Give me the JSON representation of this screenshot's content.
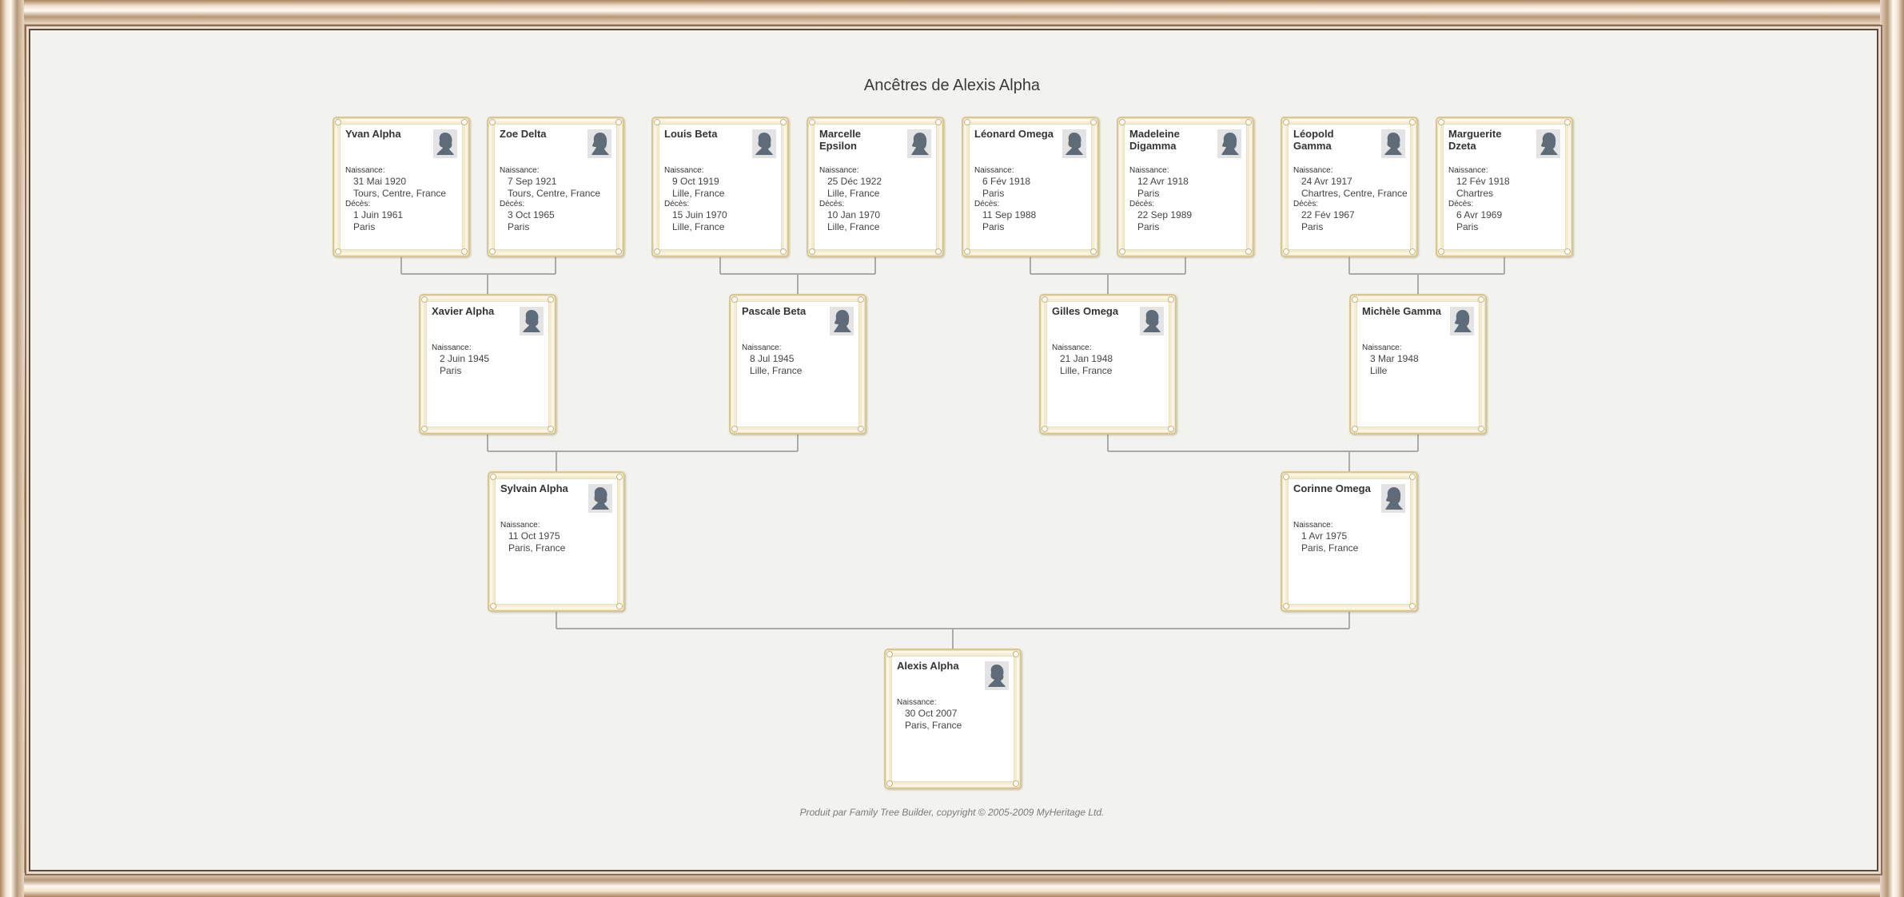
{
  "title": "Ancêtres de Alexis Alpha",
  "footer": "Produit par Family Tree Builder, copyright © 2005-2009 MyHeritage Ltd.",
  "colors": {
    "card_border": "#d9c78f",
    "connector": "#aaaaaa",
    "background": "#f2f2ee"
  },
  "labels": {
    "birth": "Naissance:",
    "death": "Décès:"
  },
  "persons": [
    {
      "id": "p1",
      "name": "Yvan Alpha",
      "icon": "male-silhouette-icon",
      "birth_date": "31 Mai 1920",
      "birth_place": "Tours, Centre, France",
      "death_date": "1 Juin 1961",
      "death_place": "Paris"
    },
    {
      "id": "p2",
      "name": "Zoe Delta",
      "icon": "female-silhouette-icon",
      "birth_date": "7 Sep 1921",
      "birth_place": "Tours, Centre, France",
      "death_date": "3 Oct 1965",
      "death_place": "Paris"
    },
    {
      "id": "p3",
      "name": "Louis Beta",
      "icon": "male-silhouette-icon",
      "birth_date": "9 Oct 1919",
      "birth_place": "Lille, France",
      "death_date": "15 Juin 1970",
      "death_place": "Lille, France"
    },
    {
      "id": "p4",
      "name": "Marcelle Epsilon",
      "icon": "female-silhouette-icon",
      "birth_date": "25 Déc 1922",
      "birth_place": "Lille, France",
      "death_date": "10 Jan 1970",
      "death_place": "Lille, France"
    },
    {
      "id": "p5",
      "name": "Léonard Omega",
      "icon": "male-silhouette-icon",
      "birth_date": "6 Fév 1918",
      "birth_place": "Paris",
      "death_date": "11 Sep 1988",
      "death_place": "Paris"
    },
    {
      "id": "p6",
      "name": "Madeleine Digamma",
      "icon": "female-silhouette-icon",
      "birth_date": "12 Avr 1918",
      "birth_place": "Paris",
      "death_date": "22 Sep 1989",
      "death_place": "Paris"
    },
    {
      "id": "p7",
      "name": "Léopold Gamma",
      "icon": "male-silhouette-icon",
      "birth_date": "24 Avr 1917",
      "birth_place": "Chartres, Centre, France",
      "death_date": "22 Fév 1967",
      "death_place": "Paris"
    },
    {
      "id": "p8",
      "name": "Marguerite Dzeta",
      "icon": "female-silhouette-icon",
      "birth_date": "12 Fév 1918",
      "birth_place": "Chartres",
      "death_date": "6 Avr 1969",
      "death_place": "Paris"
    },
    {
      "id": "p9",
      "name": "Xavier Alpha",
      "icon": "male-silhouette-icon",
      "birth_date": "2 Juin 1945",
      "birth_place": "Paris"
    },
    {
      "id": "p10",
      "name": "Pascale Beta",
      "icon": "female-silhouette-icon",
      "birth_date": "8 Jul 1945",
      "birth_place": "Lille, France"
    },
    {
      "id": "p11",
      "name": "Gilles Omega",
      "icon": "male-silhouette-icon",
      "birth_date": "21 Jan 1948",
      "birth_place": "Lille, France"
    },
    {
      "id": "p12",
      "name": "Michèle Gamma",
      "icon": "female-silhouette-icon",
      "birth_date": "3 Mar 1948",
      "birth_place": "Lille"
    },
    {
      "id": "p13",
      "name": "Sylvain Alpha",
      "icon": "male-silhouette-icon",
      "birth_date": "11 Oct 1975",
      "birth_place": "Paris, France"
    },
    {
      "id": "p14",
      "name": "Corinne Omega",
      "icon": "female-silhouette-icon",
      "birth_date": "1 Avr 1975",
      "birth_place": "Paris, France"
    },
    {
      "id": "p15",
      "name": "Alexis Alpha",
      "icon": "male-silhouette-icon",
      "birth_date": "30 Oct 2007",
      "birth_place": "Paris, France"
    }
  ],
  "relations": [
    {
      "child": "p9",
      "father": "p1",
      "mother": "p2"
    },
    {
      "child": "p10",
      "father": "p3",
      "mother": "p4"
    },
    {
      "child": "p11",
      "father": "p5",
      "mother": "p6"
    },
    {
      "child": "p12",
      "father": "p7",
      "mother": "p8"
    },
    {
      "child": "p13",
      "father": "p9",
      "mother": "p10"
    },
    {
      "child": "p14",
      "father": "p11",
      "mother": "p12"
    },
    {
      "child": "p15",
      "father": "p13",
      "mother": "p14"
    }
  ]
}
